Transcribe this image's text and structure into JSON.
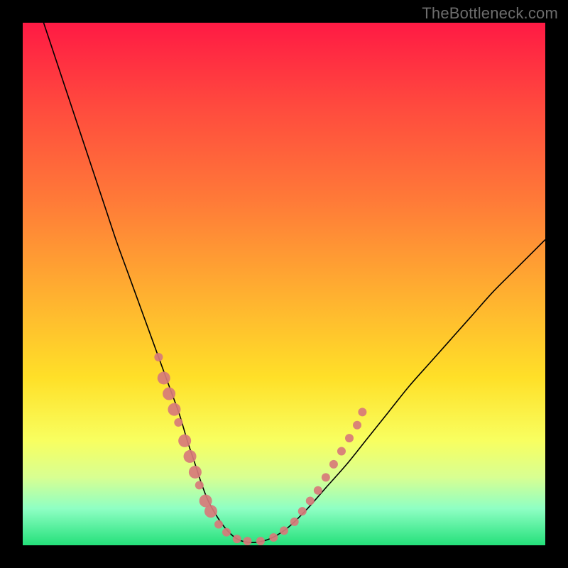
{
  "watermark": "TheBottleneck.com",
  "chart_data": {
    "type": "line",
    "title": "",
    "xlabel": "",
    "ylabel": "",
    "xlim": [
      0,
      100
    ],
    "ylim": [
      0,
      100
    ],
    "grid": false,
    "legend": false,
    "series": [
      {
        "name": "curve",
        "x": [
          4,
          6,
          8,
          10,
          12,
          14,
          16,
          18,
          20,
          22,
          24,
          26,
          28,
          30,
          31.5,
          33,
          34.5,
          36,
          39,
          42,
          46,
          50,
          54,
          58,
          62,
          66,
          70,
          74,
          78,
          82,
          86,
          90,
          94,
          98,
          100
        ],
        "y": [
          100,
          94,
          88,
          82,
          76,
          70,
          64,
          58,
          52.5,
          47,
          41.5,
          36,
          30.5,
          25,
          20,
          15.5,
          11,
          7.5,
          3.0,
          0.8,
          0.8,
          2.8,
          6.5,
          11,
          15.5,
          20.5,
          25.5,
          30.5,
          35,
          39.5,
          44,
          48.5,
          52.5,
          56.5,
          58.5
        ]
      }
    ],
    "markers": [
      {
        "x": 26.0,
        "y": 36.0,
        "r": 6
      },
      {
        "x": 27.0,
        "y": 32.0,
        "r": 9
      },
      {
        "x": 28.0,
        "y": 29.0,
        "r": 9
      },
      {
        "x": 29.0,
        "y": 26.0,
        "r": 9
      },
      {
        "x": 29.8,
        "y": 23.5,
        "r": 6
      },
      {
        "x": 31.0,
        "y": 20.0,
        "r": 9
      },
      {
        "x": 32.0,
        "y": 17.0,
        "r": 9
      },
      {
        "x": 33.0,
        "y": 14.0,
        "r": 9
      },
      {
        "x": 33.8,
        "y": 11.5,
        "r": 6
      },
      {
        "x": 35.0,
        "y": 8.5,
        "r": 9
      },
      {
        "x": 36.0,
        "y": 6.5,
        "r": 9
      },
      {
        "x": 37.5,
        "y": 4.0,
        "r": 6
      },
      {
        "x": 39.0,
        "y": 2.5,
        "r": 6
      },
      {
        "x": 41.0,
        "y": 1.2,
        "r": 6
      },
      {
        "x": 43.0,
        "y": 0.8,
        "r": 6
      },
      {
        "x": 45.5,
        "y": 0.8,
        "r": 6
      },
      {
        "x": 48.0,
        "y": 1.5,
        "r": 6
      },
      {
        "x": 50.0,
        "y": 2.8,
        "r": 6
      },
      {
        "x": 52.0,
        "y": 4.5,
        "r": 6
      },
      {
        "x": 53.5,
        "y": 6.5,
        "r": 6
      },
      {
        "x": 55.0,
        "y": 8.5,
        "r": 6
      },
      {
        "x": 56.5,
        "y": 10.5,
        "r": 6
      },
      {
        "x": 58.0,
        "y": 13.0,
        "r": 6
      },
      {
        "x": 59.5,
        "y": 15.5,
        "r": 6
      },
      {
        "x": 61.0,
        "y": 18.0,
        "r": 6
      },
      {
        "x": 62.5,
        "y": 20.5,
        "r": 6
      },
      {
        "x": 64.0,
        "y": 23.0,
        "r": 6
      },
      {
        "x": 65.0,
        "y": 25.5,
        "r": 6
      }
    ]
  }
}
